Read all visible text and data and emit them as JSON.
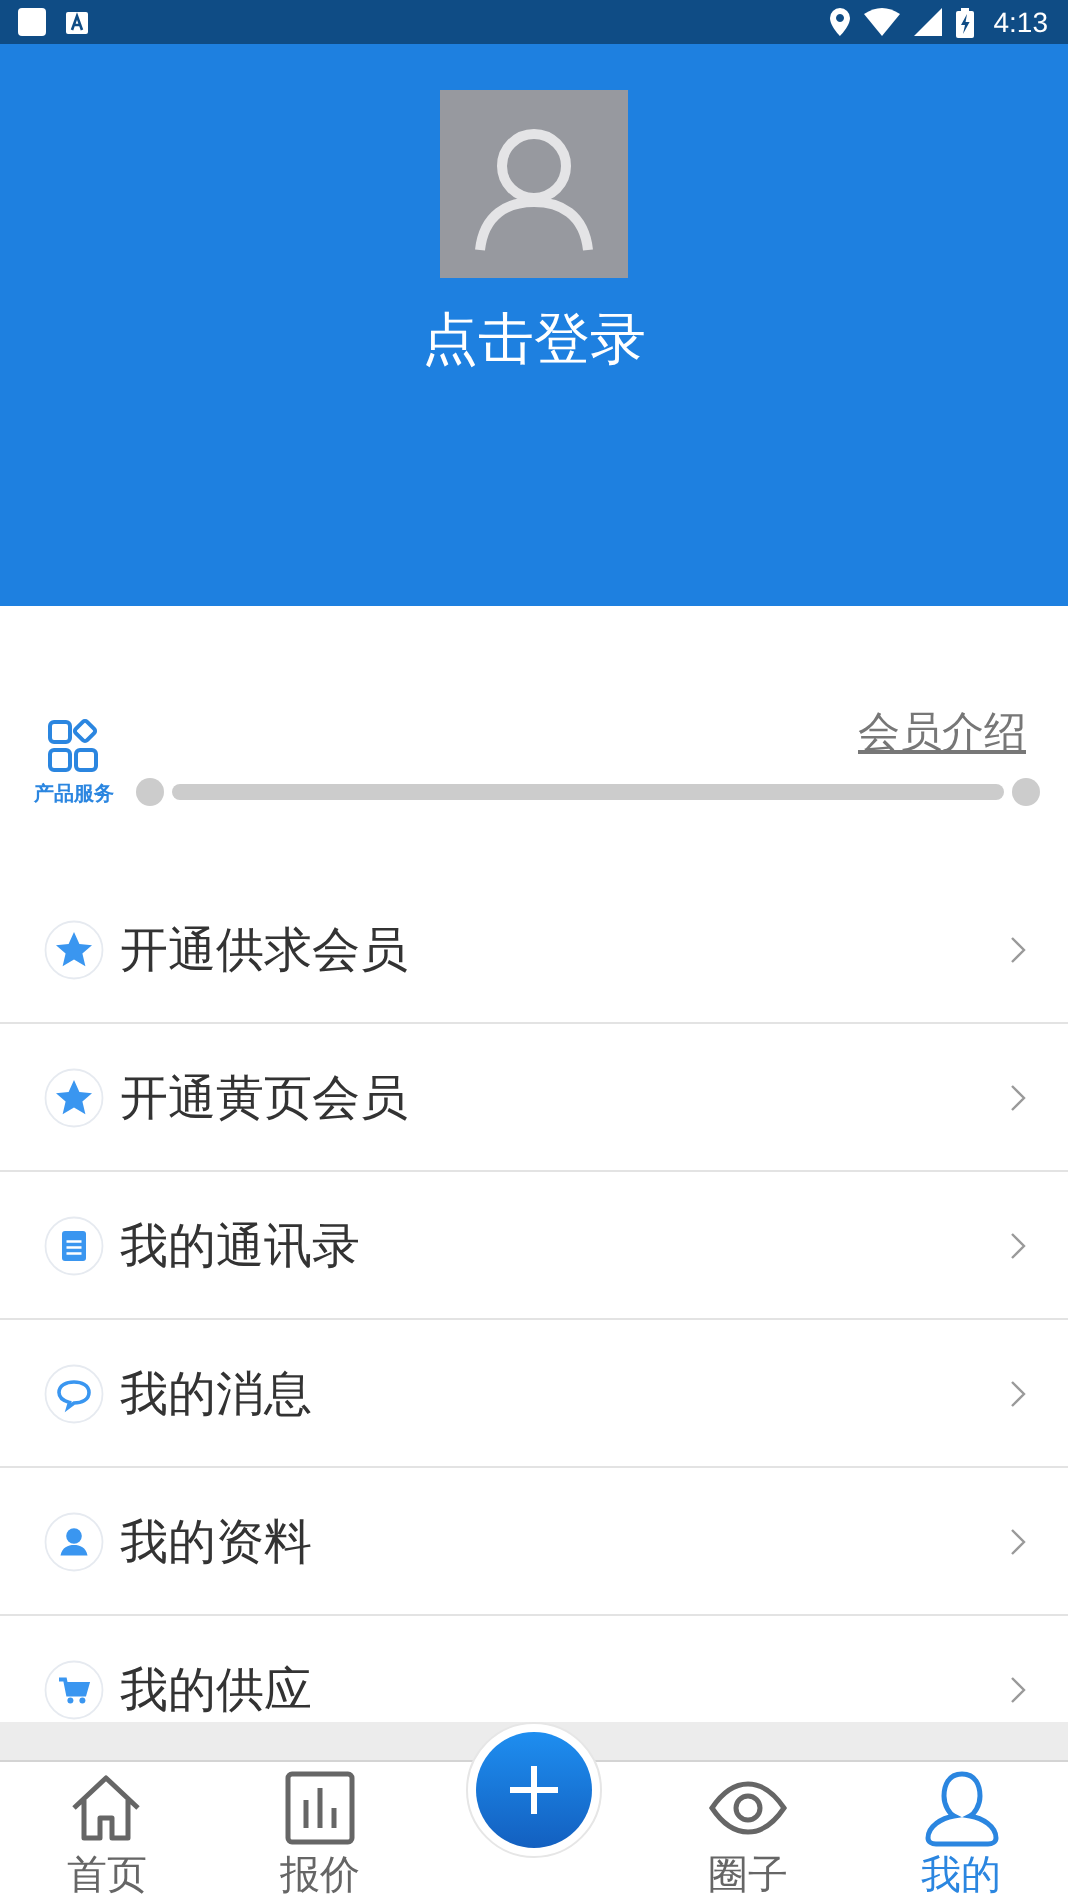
{
  "status_bar": {
    "time": "4:13"
  },
  "profile": {
    "login_label": "点击登录"
  },
  "membership": {
    "service_label": "产品服务",
    "intro_link": "会员介绍"
  },
  "menu": [
    {
      "label": "开通供求会员",
      "kind": "star"
    },
    {
      "label": "开通黄页会员",
      "kind": "star"
    },
    {
      "label": "我的通讯录",
      "kind": "notepad"
    },
    {
      "label": "我的消息",
      "kind": "chat"
    },
    {
      "label": "我的资料",
      "kind": "person"
    },
    {
      "label": "我的供应",
      "kind": "cart"
    }
  ],
  "tabs": [
    {
      "label": "首页",
      "kind": "home",
      "selected": false
    },
    {
      "label": "报价",
      "kind": "chart",
      "selected": false
    },
    {
      "kind": "add",
      "selected": false
    },
    {
      "label": "圈子",
      "kind": "eye",
      "selected": false
    },
    {
      "label": "我的",
      "kind": "person",
      "selected": true
    }
  ]
}
